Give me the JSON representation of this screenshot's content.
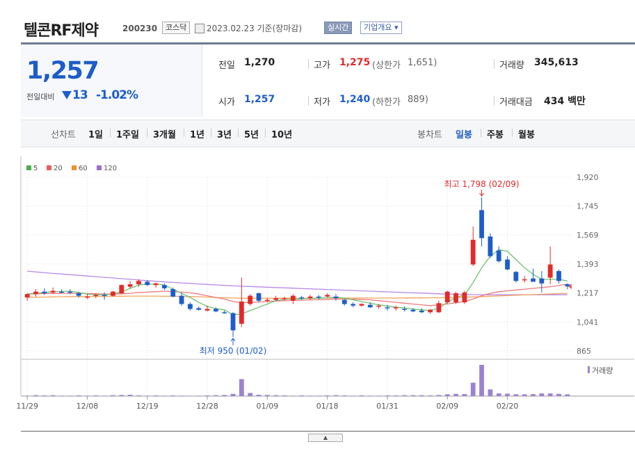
{
  "header": {
    "name": "텔콘RF제약",
    "code": "200230",
    "market": "코스닥",
    "date": "2023.02.23 기준(장마감)",
    "realtime_label": "실시간",
    "company_label": "기업개요 ▾"
  },
  "quote": {
    "price": "1,257",
    "change_label": "전일대비",
    "change_value": "13",
    "change_pct": "-1.02%",
    "prev_close_label": "전일",
    "prev_close": "1,270",
    "high_label": "고가",
    "high": "1,275",
    "upper_limit_label": "(상한가",
    "upper_limit": "1,651)",
    "volume_label": "거래량",
    "volume": "345,613",
    "open_label": "시가",
    "open": "1,257",
    "low_label": "저가",
    "low": "1,240",
    "lower_limit_label": "(하한가",
    "lower_limit": "889)",
    "amount_label": "거래대금",
    "amount": "434 백만",
    "up_color": "#e32a2a",
    "down_color": "#1d5dc9"
  },
  "toolbar": {
    "line_label": "선차트",
    "periods": [
      "1일",
      "1주일",
      "3개월",
      "1년",
      "3년",
      "5년",
      "10년"
    ],
    "candle_label": "봉차트",
    "candle_types": [
      "일봉",
      "주봉",
      "월봉"
    ],
    "active_candle": "일봉"
  },
  "chart_data": {
    "type": "candlestick",
    "legend": [
      {
        "name": "5",
        "color": "#4caf50"
      },
      {
        "name": "20",
        "color": "#e85c5c"
      },
      {
        "name": "60",
        "color": "#f0922b"
      },
      {
        "name": "120",
        "color": "#9b6bd6"
      }
    ],
    "y_ticks": [
      865,
      1041,
      1217,
      1393,
      1569,
      1745,
      1920
    ],
    "y_tick_labels": [
      "865",
      "1,041",
      "1,217",
      "1,393",
      "1,569",
      "1,745",
      "1,920"
    ],
    "ylim": [
      865,
      1920
    ],
    "x_tick_labels": [
      "11/29",
      "12/08",
      "12/19",
      "12/28",
      "01/09",
      "01/18",
      "01/31",
      "02/09",
      "02/20"
    ],
    "x_tick_index": [
      0,
      7,
      14,
      21,
      28,
      35,
      42,
      49,
      56
    ],
    "max_annotation": "최고 1,798 (02/09)",
    "min_annotation": "최저 950 (01/02)",
    "volume_label": "거래량",
    "candles": [
      {
        "o": 1190,
        "h": 1215,
        "l": 1170,
        "c": 1210
      },
      {
        "o": 1210,
        "h": 1240,
        "l": 1195,
        "c": 1225
      },
      {
        "o": 1225,
        "h": 1245,
        "l": 1205,
        "c": 1215
      },
      {
        "o": 1220,
        "h": 1250,
        "l": 1210,
        "c": 1230
      },
      {
        "o": 1225,
        "h": 1240,
        "l": 1215,
        "c": 1220
      },
      {
        "o": 1225,
        "h": 1240,
        "l": 1210,
        "c": 1220
      },
      {
        "o": 1215,
        "h": 1225,
        "l": 1190,
        "c": 1200
      },
      {
        "o": 1195,
        "h": 1210,
        "l": 1180,
        "c": 1195
      },
      {
        "o": 1200,
        "h": 1215,
        "l": 1185,
        "c": 1205
      },
      {
        "o": 1205,
        "h": 1220,
        "l": 1175,
        "c": 1200
      },
      {
        "o": 1200,
        "h": 1230,
        "l": 1195,
        "c": 1225
      },
      {
        "o": 1215,
        "h": 1270,
        "l": 1210,
        "c": 1265
      },
      {
        "o": 1255,
        "h": 1290,
        "l": 1245,
        "c": 1270
      },
      {
        "o": 1270,
        "h": 1300,
        "l": 1255,
        "c": 1290
      },
      {
        "o": 1285,
        "h": 1295,
        "l": 1260,
        "c": 1265
      },
      {
        "o": 1265,
        "h": 1280,
        "l": 1250,
        "c": 1275
      },
      {
        "o": 1265,
        "h": 1275,
        "l": 1235,
        "c": 1245
      },
      {
        "o": 1240,
        "h": 1250,
        "l": 1190,
        "c": 1195
      },
      {
        "o": 1200,
        "h": 1215,
        "l": 1140,
        "c": 1150
      },
      {
        "o": 1150,
        "h": 1160,
        "l": 1110,
        "c": 1120
      },
      {
        "o": 1125,
        "h": 1135,
        "l": 1110,
        "c": 1115
      },
      {
        "o": 1110,
        "h": 1140,
        "l": 1105,
        "c": 1120
      },
      {
        "o": 1120,
        "h": 1130,
        "l": 1100,
        "c": 1105
      },
      {
        "o": 1100,
        "h": 1110,
        "l": 1090,
        "c": 1095
      },
      {
        "o": 1095,
        "h": 1100,
        "l": 950,
        "c": 990
      },
      {
        "o": 1030,
        "h": 1310,
        "l": 1010,
        "c": 1165
      },
      {
        "o": 1150,
        "h": 1210,
        "l": 1140,
        "c": 1200
      },
      {
        "o": 1215,
        "h": 1220,
        "l": 1160,
        "c": 1170
      },
      {
        "o": 1170,
        "h": 1185,
        "l": 1160,
        "c": 1175
      },
      {
        "o": 1175,
        "h": 1200,
        "l": 1165,
        "c": 1185
      },
      {
        "o": 1180,
        "h": 1195,
        "l": 1170,
        "c": 1185
      },
      {
        "o": 1170,
        "h": 1210,
        "l": 1150,
        "c": 1200
      },
      {
        "o": 1190,
        "h": 1200,
        "l": 1175,
        "c": 1185
      },
      {
        "o": 1185,
        "h": 1205,
        "l": 1175,
        "c": 1195
      },
      {
        "o": 1195,
        "h": 1205,
        "l": 1180,
        "c": 1190
      },
      {
        "o": 1195,
        "h": 1215,
        "l": 1190,
        "c": 1205
      },
      {
        "o": 1195,
        "h": 1210,
        "l": 1170,
        "c": 1185
      },
      {
        "o": 1175,
        "h": 1180,
        "l": 1140,
        "c": 1150
      },
      {
        "o": 1150,
        "h": 1160,
        "l": 1130,
        "c": 1140
      },
      {
        "o": 1140,
        "h": 1155,
        "l": 1135,
        "c": 1150
      },
      {
        "o": 1145,
        "h": 1160,
        "l": 1125,
        "c": 1130
      },
      {
        "o": 1135,
        "h": 1150,
        "l": 1120,
        "c": 1140
      },
      {
        "o": 1130,
        "h": 1145,
        "l": 1110,
        "c": 1125
      },
      {
        "o": 1125,
        "h": 1140,
        "l": 1110,
        "c": 1130
      },
      {
        "o": 1120,
        "h": 1135,
        "l": 1105,
        "c": 1115
      },
      {
        "o": 1115,
        "h": 1125,
        "l": 1100,
        "c": 1105
      },
      {
        "o": 1110,
        "h": 1125,
        "l": 1095,
        "c": 1100
      },
      {
        "o": 1100,
        "h": 1120,
        "l": 1090,
        "c": 1115
      },
      {
        "o": 1100,
        "h": 1170,
        "l": 1095,
        "c": 1155
      },
      {
        "o": 1160,
        "h": 1230,
        "l": 1150,
        "c": 1225
      },
      {
        "o": 1160,
        "h": 1225,
        "l": 1150,
        "c": 1215
      },
      {
        "o": 1160,
        "h": 1230,
        "l": 1150,
        "c": 1220
      },
      {
        "o": 1390,
        "h": 1620,
        "l": 1380,
        "c": 1540
      },
      {
        "o": 1720,
        "h": 1798,
        "l": 1500,
        "c": 1550
      },
      {
        "o": 1560,
        "h": 1580,
        "l": 1430,
        "c": 1440
      },
      {
        "o": 1475,
        "h": 1500,
        "l": 1400,
        "c": 1410
      },
      {
        "o": 1420,
        "h": 1440,
        "l": 1355,
        "c": 1360
      },
      {
        "o": 1345,
        "h": 1350,
        "l": 1280,
        "c": 1290
      },
      {
        "o": 1300,
        "h": 1320,
        "l": 1280,
        "c": 1300
      },
      {
        "o": 1305,
        "h": 1365,
        "l": 1295,
        "c": 1285
      },
      {
        "o": 1305,
        "h": 1350,
        "l": 1220,
        "c": 1275
      },
      {
        "o": 1310,
        "h": 1500,
        "l": 1270,
        "c": 1390
      },
      {
        "o": 1350,
        "h": 1360,
        "l": 1275,
        "c": 1290
      },
      {
        "o": 1270,
        "h": 1275,
        "l": 1240,
        "c": 1257
      }
    ],
    "ma5": [
      1210,
      1215,
      1220,
      1225,
      1226,
      1228,
      1220,
      1210,
      1205,
      1205,
      1210,
      1225,
      1245,
      1265,
      1270,
      1272,
      1265,
      1240,
      1215,
      1190,
      1160,
      1135,
      1122,
      1115,
      1085,
      1090,
      1110,
      1130,
      1150,
      1170,
      1180,
      1180,
      1182,
      1185,
      1185,
      1188,
      1192,
      1186,
      1175,
      1165,
      1155,
      1145,
      1138,
      1130,
      1126,
      1120,
      1115,
      1110,
      1125,
      1160,
      1190,
      1205,
      1280,
      1370,
      1440,
      1480,
      1470,
      1420,
      1370,
      1330,
      1300,
      1300,
      1300,
      1290
    ],
    "ma20": [
      1210,
      1212,
      1213,
      1214,
      1215,
      1215,
      1214,
      1213,
      1212,
      1210,
      1210,
      1212,
      1215,
      1220,
      1222,
      1225,
      1228,
      1225,
      1222,
      1218,
      1210,
      1200,
      1190,
      1180,
      1165,
      1158,
      1160,
      1162,
      1165,
      1168,
      1170,
      1172,
      1173,
      1175,
      1176,
      1178,
      1180,
      1180,
      1180,
      1178,
      1175,
      1170,
      1165,
      1160,
      1155,
      1150,
      1145,
      1140,
      1145,
      1150,
      1158,
      1165,
      1180,
      1200,
      1215,
      1225,
      1230,
      1235,
      1240,
      1245,
      1250,
      1255,
      1262,
      1270
    ],
    "ma60": [
      1190,
      1191,
      1192,
      1193,
      1194,
      1195,
      1195,
      1195,
      1196,
      1196,
      1197,
      1197,
      1198,
      1198,
      1198,
      1198,
      1197,
      1197,
      1196,
      1195,
      1194,
      1192,
      1190,
      1188,
      1186,
      1185,
      1185,
      1185,
      1185,
      1185,
      1185,
      1185,
      1185,
      1185,
      1186,
      1186,
      1186,
      1186,
      1186,
      1186,
      1186,
      1186,
      1186,
      1186,
      1187,
      1187,
      1187,
      1188,
      1188,
      1189,
      1190,
      1191,
      1193,
      1195,
      1197,
      1199,
      1201,
      1203,
      1205,
      1207,
      1209,
      1211,
      1213,
      1215
    ],
    "ma120": [
      1350,
      1345,
      1340,
      1336,
      1332,
      1328,
      1324,
      1320,
      1316,
      1312,
      1308,
      1304,
      1300,
      1296,
      1292,
      1288,
      1284,
      1281,
      1278,
      1275,
      1272,
      1269,
      1266,
      1263,
      1260,
      1258,
      1256,
      1254,
      1252,
      1250,
      1248,
      1246,
      1244,
      1242,
      1240,
      1238,
      1236,
      1234,
      1232,
      1230,
      1228,
      1226,
      1224,
      1222,
      1220,
      1218,
      1216,
      1214,
      1212,
      1210,
      1209,
      1208,
      1207,
      1206,
      1206,
      1206,
      1206,
      1206,
      1206,
      1206,
      1206,
      1206,
      1206,
      1206
    ],
    "volumes": [
      10,
      20,
      15,
      20,
      10,
      10,
      15,
      10,
      15,
      10,
      20,
      25,
      30,
      15,
      10,
      15,
      10,
      15,
      10,
      5,
      10,
      15,
      20,
      25,
      50,
      380,
      70,
      30,
      25,
      20,
      15,
      10,
      15,
      10,
      10,
      15,
      20,
      15,
      10,
      15,
      10,
      10,
      15,
      15,
      20,
      20,
      20,
      15,
      25,
      40,
      50,
      45,
      300,
      700,
      150,
      60,
      55,
      40,
      40,
      45,
      60,
      60,
      50,
      40
    ]
  }
}
